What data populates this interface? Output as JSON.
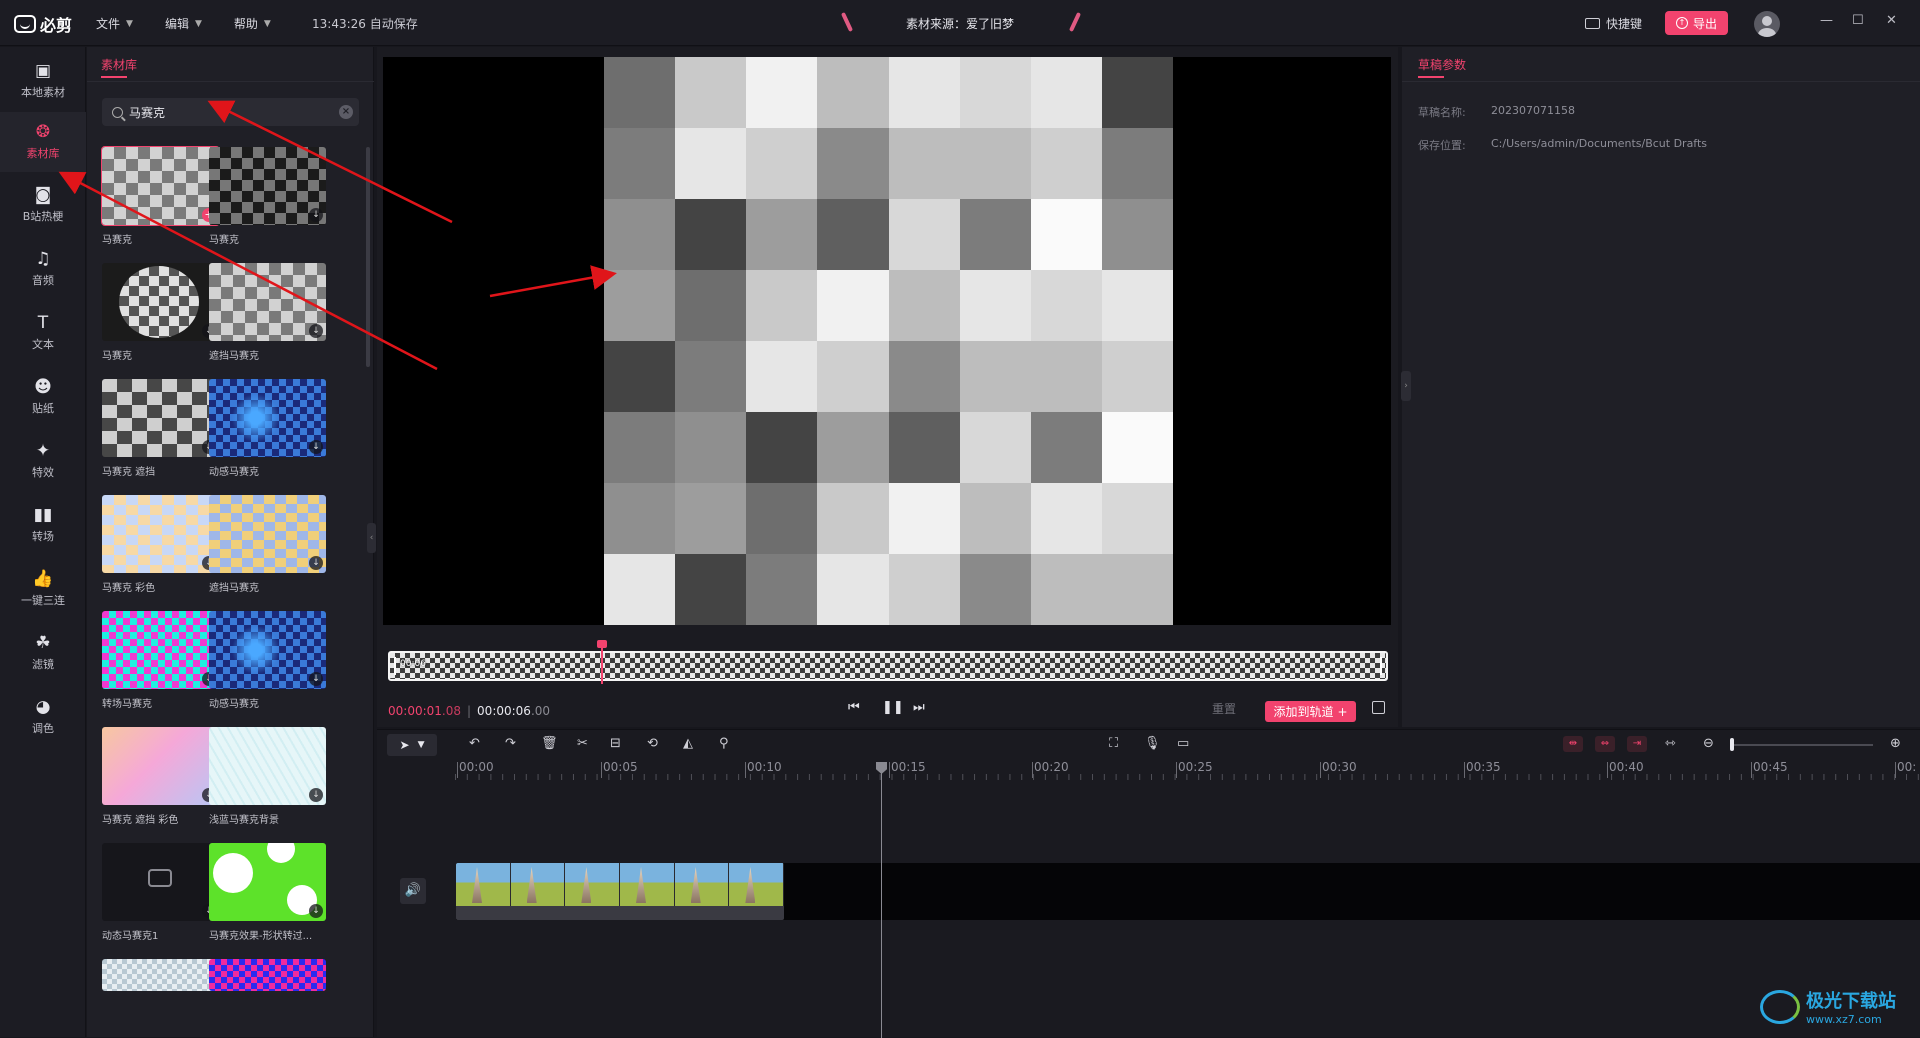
{
  "app": {
    "logo_text": "必剪",
    "autosave": "13:43:26 自动保存",
    "source_title": "素材来源：爱了旧梦"
  },
  "menus": [
    {
      "label": "文件"
    },
    {
      "label": "编辑"
    },
    {
      "label": "帮助"
    }
  ],
  "header": {
    "shortcut_label": "快捷键",
    "export_label": "导出"
  },
  "nav": [
    {
      "label": "本地素材",
      "icon": "folder-icon"
    },
    {
      "label": "素材库",
      "icon": "library-icon",
      "active": true
    },
    {
      "label": "B站热梗",
      "icon": "bilibili-icon"
    },
    {
      "label": "音频",
      "icon": "music-icon"
    },
    {
      "label": "文本",
      "icon": "text-icon"
    },
    {
      "label": "贴纸",
      "icon": "sticker-icon"
    },
    {
      "label": "特效",
      "icon": "effect-icon"
    },
    {
      "label": "转场",
      "icon": "transition-icon"
    },
    {
      "label": "一键三连",
      "icon": "thumbs-up-icon"
    },
    {
      "label": "滤镜",
      "icon": "filter-icon"
    },
    {
      "label": "调色",
      "icon": "palette-icon"
    }
  ],
  "assets": {
    "tab": "素材库",
    "search_value": "马赛克",
    "items": [
      {
        "label": "马赛克"
      },
      {
        "label": "马赛克"
      },
      {
        "label": "马赛克"
      },
      {
        "label": "遮挡马赛克"
      },
      {
        "label": "马赛克 遮挡"
      },
      {
        "label": "动感马赛克"
      },
      {
        "label": "马赛克  彩色"
      },
      {
        "label": "遮挡马赛克"
      },
      {
        "label": "转场马赛克"
      },
      {
        "label": "动感马赛克"
      },
      {
        "label": "马赛克 遮挡 彩色"
      },
      {
        "label": "浅蓝马赛克背景"
      },
      {
        "label": "动态马赛克1"
      },
      {
        "label": "马赛克效果-形状转过..."
      }
    ]
  },
  "player": {
    "strip_time": "00:06",
    "current_time": "00:00:01",
    "current_frames": ".08",
    "total_time": "00:00:06",
    "total_frames": ".00",
    "reset_label": "重置",
    "add_to_track_label": "添加到轨道"
  },
  "params": {
    "tab": "草稿参数",
    "name_label": "草稿名称:",
    "name_value": "202307071158",
    "path_label": "保存位置:",
    "path_value": "C:/Users/admin/Documents/Bcut Drafts"
  },
  "timeline": {
    "ticks": [
      "00:00",
      "00:05",
      "00:10",
      "00:15",
      "00:20",
      "00:25",
      "00:30",
      "00:35",
      "00:40",
      "00:45",
      "00:"
    ]
  },
  "watermark": {
    "text": "极光下载站",
    "url": "www.xz7.com"
  },
  "colors": {
    "accent": "#f2436e",
    "bg": "#17171d",
    "panel": "#1f1f26",
    "annotation_arrow": "#e0151a"
  }
}
